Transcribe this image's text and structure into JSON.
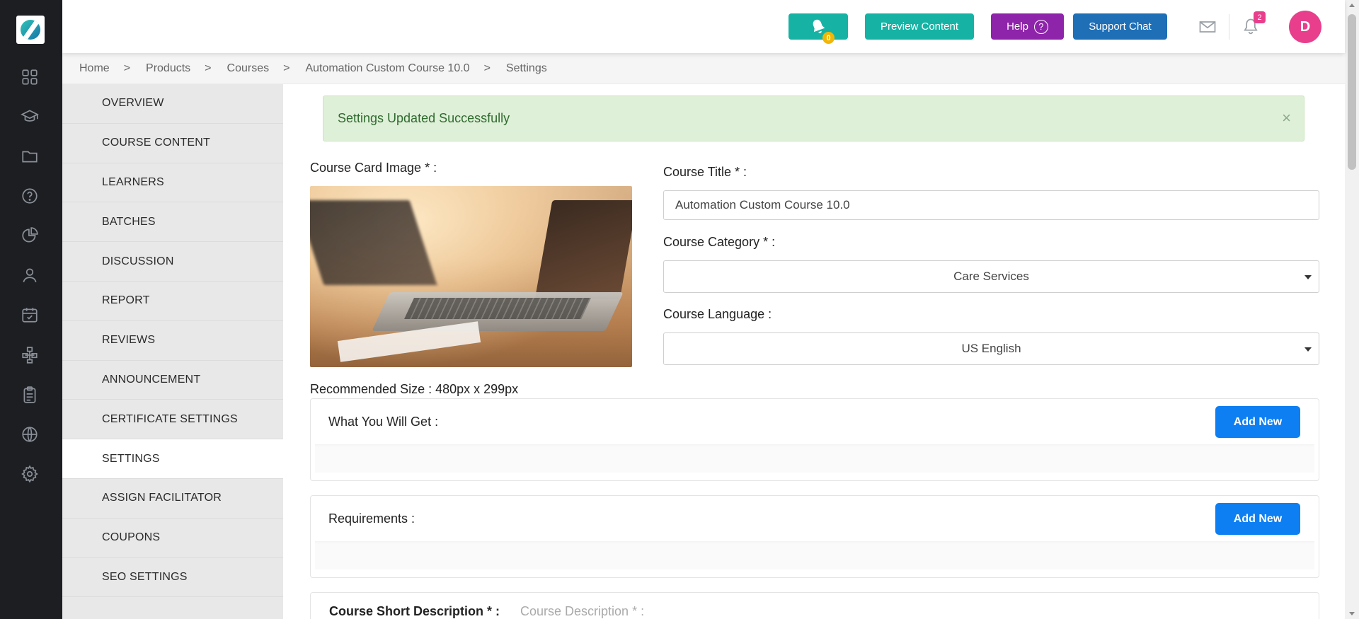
{
  "header": {
    "bell_count": "0",
    "preview_label": "Preview Content",
    "help_label": "Help",
    "help_glyph": "?",
    "support_label": "Support Chat",
    "notif_count": "2",
    "avatar_initial": "D"
  },
  "breadcrumb": {
    "items": [
      "Home",
      "Products",
      "Courses",
      "Automation Custom Course 10.0",
      "Settings"
    ],
    "separator": ">"
  },
  "subnav": {
    "items": [
      {
        "label": "OVERVIEW"
      },
      {
        "label": "COURSE CONTENT"
      },
      {
        "label": "LEARNERS"
      },
      {
        "label": "BATCHES"
      },
      {
        "label": "DISCUSSION"
      },
      {
        "label": "REPORT"
      },
      {
        "label": "REVIEWS"
      },
      {
        "label": "ANNOUNCEMENT"
      },
      {
        "label": "CERTIFICATE SETTINGS"
      },
      {
        "label": "SETTINGS"
      },
      {
        "label": "ASSIGN FACILITATOR"
      },
      {
        "label": "COUPONS"
      },
      {
        "label": "SEO SETTINGS"
      }
    ],
    "active": "SETTINGS"
  },
  "alert": {
    "message": "Settings Updated Successfully",
    "close_glyph": "×"
  },
  "form": {
    "card_image_label": "Course Card Image * :",
    "recommended_size": "Recommended Size : 480px x 299px",
    "title_label": "Course Title * :",
    "title_value": "Automation Custom Course 10.0",
    "category_label": "Course Category * :",
    "category_value": "Care Services",
    "language_label": "Course Language :",
    "language_value": "US English"
  },
  "panels": {
    "what_you_get": {
      "title": "What You Will Get :",
      "button": "Add New"
    },
    "requirements": {
      "title": "Requirements :",
      "button": "Add New"
    },
    "short_desc_label": "Course Short Description * :",
    "desc_label": "Course Description * :"
  },
  "colors": {
    "rail_bg": "#1c1e22",
    "teal": "#16b3a5",
    "purple": "#8e24aa",
    "support_blue": "#1f6fb7",
    "pink": "#e83e8c",
    "add_blue": "#0d7ff2",
    "alert_bg": "#dff0d8"
  },
  "icons": {
    "rail": [
      "dashboard-icon",
      "graduation-cap-icon",
      "folder-icon",
      "help-circle-icon",
      "pie-chart-icon",
      "user-icon",
      "calendar-check-icon",
      "hierarchy-icon",
      "clipboard-icon",
      "globe-icon",
      "settings-gear-icon"
    ]
  }
}
